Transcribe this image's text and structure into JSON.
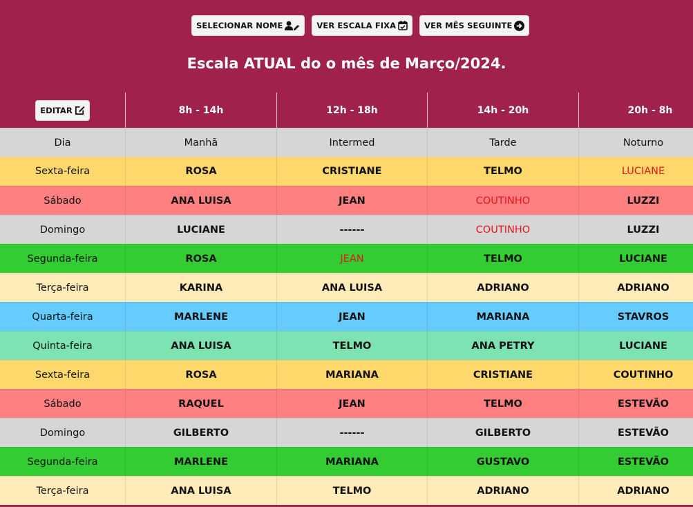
{
  "toolbar": {
    "select_name": "SELECIONAR NOME",
    "fixed_scale": "VER ESCALA FIXA",
    "next_month": "VER MÊS SEGUINTE"
  },
  "title": "Escala ATUAL do o mês de Março/2024.",
  "edit_label": "EDITAR",
  "shifts": [
    "8h - 14h",
    "12h - 18h",
    "14h - 20h",
    "20h - 8h"
  ],
  "subheader": [
    "Dia",
    "Manhã",
    "Intermed",
    "Tarde",
    "Noturno"
  ],
  "colors": {
    "header": "#a0214a",
    "gray": "#d6d6d6",
    "yellow": "#ffd86b",
    "pink": "#ff8080",
    "green": "#33cc33",
    "cream": "#ffecb8",
    "blue": "#66ccff",
    "mint": "#7de3b3",
    "red_text": "#e8141b"
  },
  "rows": [
    {
      "bg": "#ffd86b",
      "cells": [
        "Sexta-feira",
        "ROSA",
        "CRISTIANE",
        "TELMO",
        "LUCIANE"
      ],
      "red": [
        4
      ]
    },
    {
      "bg": "#ff8080",
      "cells": [
        "Sábado",
        "ANA LUISA",
        "JEAN",
        "COUTINHO",
        "LUZZI"
      ],
      "red": [
        3
      ]
    },
    {
      "bg": "#d6d6d6",
      "cells": [
        "Domingo",
        "LUCIANE",
        "------",
        "COUTINHO",
        "LUZZI"
      ],
      "red": [
        3
      ]
    },
    {
      "bg": "#33cc33",
      "cells": [
        "Segunda-feira",
        "ROSA",
        "JEAN",
        "TELMO",
        "LUCIANE"
      ],
      "red": [
        2
      ]
    },
    {
      "bg": "#ffecb8",
      "cells": [
        "Terça-feira",
        "KARINA",
        "ANA LUISA",
        "ADRIANO",
        "ADRIANO"
      ],
      "red": []
    },
    {
      "bg": "#66ccff",
      "cells": [
        "Quarta-feira",
        "MARLENE",
        "JEAN",
        "MARIANA",
        "STAVROS"
      ],
      "red": []
    },
    {
      "bg": "#7de3b3",
      "cells": [
        "Quinta-feira",
        "ANA LUISA",
        "TELMO",
        "ANA PETRY",
        "LUCIANE"
      ],
      "red": []
    },
    {
      "bg": "#ffd86b",
      "cells": [
        "Sexta-feira",
        "ROSA",
        "MARIANA",
        "CRISTIANE",
        "COUTINHO"
      ],
      "red": []
    },
    {
      "bg": "#ff8080",
      "cells": [
        "Sábado",
        "RAQUEL",
        "JEAN",
        "TELMO",
        "ESTEVÃO"
      ],
      "red": []
    },
    {
      "bg": "#d6d6d6",
      "cells": [
        "Domingo",
        "GILBERTO",
        "------",
        "GILBERTO",
        "ESTEVÃO"
      ],
      "red": []
    },
    {
      "bg": "#33cc33",
      "cells": [
        "Segunda-feira",
        "MARLENE",
        "MARIANA",
        "GUSTAVO",
        "ESTEVÃO"
      ],
      "red": []
    },
    {
      "bg": "#ffecb8",
      "cells": [
        "Terça-feira",
        "ANA LUISA",
        "TELMO",
        "ADRIANO",
        "ADRIANO"
      ],
      "red": []
    }
  ]
}
